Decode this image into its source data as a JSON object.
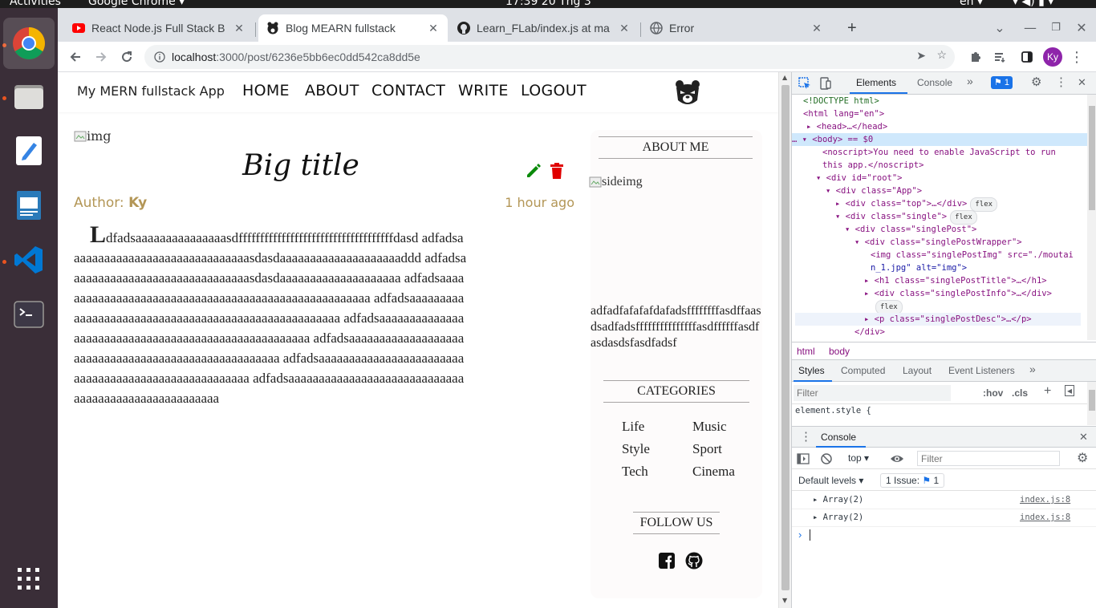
{
  "topbar": {
    "activities": "Activities",
    "app_name": "Google Chrome",
    "clock": "17:39  20 Thg 3",
    "lang": "en"
  },
  "browser": {
    "tabs": [
      {
        "title": "React Node.js Full Stack B",
        "active": false
      },
      {
        "title": "Blog MEARN fullstack",
        "active": true
      },
      {
        "title": "Learn_FLab/index.js at ma",
        "active": false
      },
      {
        "title": "Error",
        "active": false
      }
    ],
    "new_tab": "+",
    "url_host": "localhost",
    "url_path": ":3000/post/6236e5bb6ec0dd542ca8dd5e",
    "profile_initials": "Ky"
  },
  "page": {
    "app_title": "My MERN fullstack App",
    "nav": [
      "HOME",
      "ABOUT",
      "CONTACT",
      "WRITE",
      "LOGOUT"
    ],
    "post": {
      "img_alt": "img",
      "title": "Big title",
      "author_label": "Author: ",
      "author": "Ky",
      "date": "1 hour ago",
      "dropcap": "L",
      "desc": "dfadsaaaaaaaaaaaaaaasdffffffffffffffffffffffffffffffffffffdasd adfadsaaaaaaaaaaaaaaaaaaaaaaaaaaaaaasdasdaaaaaaaaaaaaaaaaaaaaddd adfadsaaaaaaaaaaaaaaaaaaaaaaaaaaaaaasdasdaaaaaaaaaaaaaaaaaaaa adfadsaaaaaaaaaaaaaaaaaaaaaaaaaaaaaaaaaaaaaaaaaaaaaaaaaaaaa adfadsaaaaaaaaaaaaaaaaaaaaaaaaaaaaaaaaaaaaaaaaaaaaaaaaaaaaa adfadsaaaaaaaaaaaaaaaaaaaaaaaaaaaaaaaaaaaaaaaaaaaaaaaaaaaaa adfadsaaaaaaaaaaaaaaaaaaaaaaaaaaaaaaaaaaaaaaaaaaaaaaaaaaaaa adfadsaaaaaaaaaaaaaaaaaaaaaaaaaaaaaaaaaaaaaaaaaaaaaaaaaaaaa adfadsaaaaaaaaaaaaaaaaaaaaaaaaaaaaaaaaaaaaaaaaaaaaaaaaaaaaa"
    },
    "sidebar": {
      "about_heading": "ABOUT ME",
      "side_img_alt": "sideimg",
      "about_text": "adfadfafafafdafadsffffffffasdffaasdsadfadsfffffffffffffffasdffffffasdfasdasdsfasdfadsf",
      "categories_heading": "CATEGORIES",
      "categories": [
        "Life",
        "Music",
        "Style",
        "Sport",
        "Tech",
        "Cinema"
      ],
      "follow_heading": "FOLLOW US"
    }
  },
  "devtools": {
    "tabs": [
      "Elements",
      "Console"
    ],
    "issues_count": "1",
    "dom": [
      "<!DOCTYPE html>",
      "<html lang=\"en\">",
      "<head>…</head>",
      "<body> == $0",
      "<noscript>You need to enable JavaScript to run",
      "this app.</noscript>",
      "<div id=\"root\">",
      "<div class=\"App\">",
      "<div class=\"top\">…</div>",
      "<div class=\"single\">",
      "<div class=\"singlePost\">",
      "<div class=\"singlePostWrapper\">",
      "<img class=\"singlePostImg\" src=\"./moutai",
      "n_1.jpg\" alt=\"img\">",
      "<h1 class=\"singlePostTitle\">…</h1>",
      "<div class=\"singlePostInfo\">…</div>",
      "<p class=\"singlePostDesc\">…</p>",
      "</div>"
    ],
    "flex_badge": "flex",
    "breadcrumb": [
      "html",
      "body"
    ],
    "styles_tabs": [
      "Styles",
      "Computed",
      "Layout",
      "Event Listeners"
    ],
    "styles_filter_placeholder": "Filter",
    "hov": ":hov",
    "cls": ".cls",
    "element_style": "element.style {",
    "console": {
      "title": "Console",
      "context": "top",
      "filter_placeholder": "Filter",
      "levels": "Default levels",
      "issue_label": "1 Issue:",
      "issue_count": "1",
      "rows": [
        {
          "text": "Array(2)",
          "source": "index.js:8"
        },
        {
          "text": "Array(2)",
          "source": "index.js:8"
        }
      ]
    }
  }
}
